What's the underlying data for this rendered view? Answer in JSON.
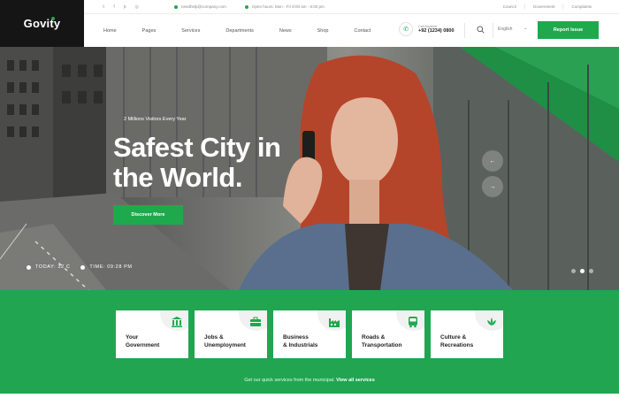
{
  "logo": "Govity",
  "topbar": {
    "social": [
      "twitter-icon",
      "facebook-icon",
      "pinterest-icon",
      "instagram-icon"
    ],
    "email": "needhelp@company.com",
    "hours": "Open hours: Mon - Fri 8:00 am - 6:00 pm",
    "links": [
      "Council",
      "Government",
      "Complaints"
    ]
  },
  "nav": {
    "items": [
      "Home",
      "Pages",
      "Services",
      "Departments",
      "News",
      "Shop",
      "Contact"
    ],
    "call_label": "Call Anytime",
    "call_number": "+92 (1234) 0800",
    "language": "English",
    "report_button": "Report Issue"
  },
  "hero": {
    "kicker": "2 Millions Visitors Every Year",
    "headline_line1": "Safest City in",
    "headline_line2": "the World.",
    "button": "Discover More",
    "today": "TODAY: 32 C",
    "time": "TIME: 09:28 PM"
  },
  "services": {
    "cards": [
      {
        "label": "Your\nGovernment",
        "icon": "government-building-icon"
      },
      {
        "label": "Jobs &\nUnemployment",
        "icon": "briefcase-icon"
      },
      {
        "label": "Business\n& Industrials",
        "icon": "factory-icon"
      },
      {
        "label": "Roads &\nTransportation",
        "icon": "bus-icon"
      },
      {
        "label": "Culture &\nRecreations",
        "icon": "lotus-icon"
      }
    ],
    "footer_text": "Get our quick services from the municipal.",
    "footer_link": "View all services"
  },
  "colors": {
    "accent": "#1ea94d",
    "services_bg": "#21a551",
    "logo_bg": "#151515"
  }
}
